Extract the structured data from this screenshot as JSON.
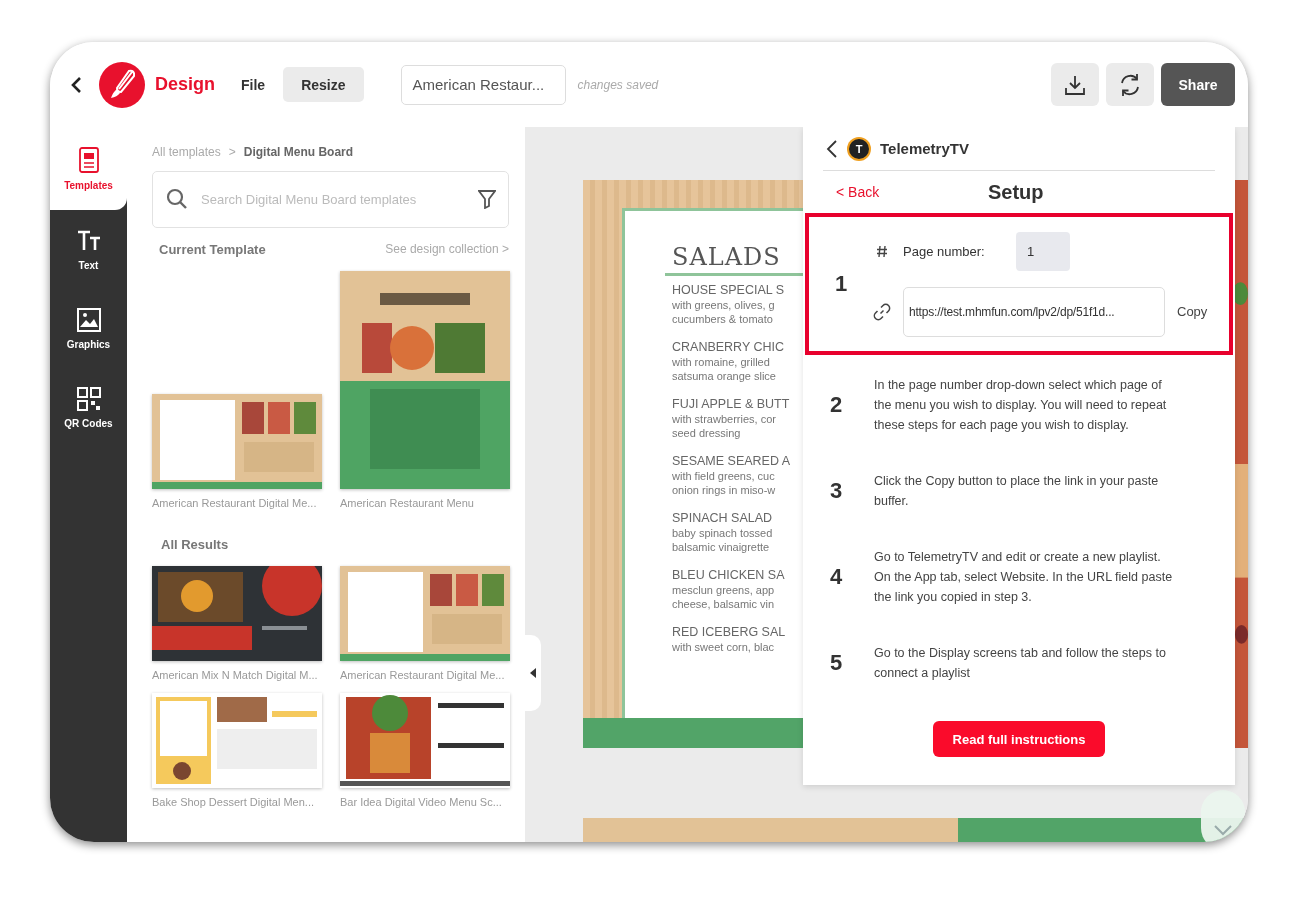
{
  "topbar": {
    "logo_text": "Design",
    "menu": [
      {
        "label": "File",
        "kind": "text"
      },
      {
        "label": "Resize",
        "kind": "button"
      }
    ],
    "document_title": "American Restaur...",
    "save_status": "changes saved",
    "share": "Share"
  },
  "rail": [
    {
      "label": "Templates",
      "selected": true
    },
    {
      "label": "Text",
      "selected": false
    },
    {
      "label": "Graphics",
      "selected": false
    },
    {
      "label": "QR Codes",
      "selected": false
    }
  ],
  "templates": {
    "breadcrumb": [
      "All templates",
      ">",
      "Digital Menu Board"
    ],
    "search_placeholder": "Search Digital Menu Board templates",
    "current_heading": "Current Template",
    "collection_link": "See design collection >",
    "current": [
      {
        "caption": "American Restaurant Digital Me...",
        "kind": "picture"
      },
      {
        "caption": "American Restaurant Menu",
        "kind": "picture"
      }
    ],
    "results_heading": "All Results",
    "results": [
      {
        "caption": "American Mix N Match Digital M...",
        "kind": "picture"
      },
      {
        "caption": "American Restaurant Digital Me...",
        "kind": "picture"
      },
      {
        "caption": "Bake Shop Dessert Digital Men...",
        "kind": "picture"
      },
      {
        "caption": "Bar Idea Digital Video Menu Sc...",
        "kind": "picture"
      }
    ]
  },
  "canvas": {
    "menu_title": "SALADS",
    "items": [
      {
        "name": "HOUSE SPECIAL S",
        "lines": [
          "with greens, olives, g",
          "cucumbers & tomato"
        ]
      },
      {
        "name": "CRANBERRY CHIC",
        "lines": [
          "with romaine, grilled",
          "satsuma orange slice"
        ]
      },
      {
        "name": "FUJI APPLE & BUTT",
        "lines": [
          "with strawberries, cor",
          "seed dressing"
        ]
      },
      {
        "name": "SESAME SEARED A",
        "lines": [
          "with field greens, cuc",
          "onion rings in miso-w"
        ]
      },
      {
        "name": "SPINACH SALAD",
        "lines": [
          "baby spinach tossed",
          "balsamic vinaigrette"
        ]
      },
      {
        "name": "BLEU CHICKEN SA",
        "lines": [
          "mesclun greens, app",
          "cheese, balsamic vin"
        ]
      },
      {
        "name": "RED ICEBERG SAL",
        "lines": [
          "with sweet corn, blac"
        ]
      }
    ]
  },
  "panel": {
    "app_name": "TelemetryTV",
    "logo_letter": "T",
    "back_link": "< Back",
    "title": "Setup",
    "step_one": {
      "number": "1",
      "page_label": "Page number:",
      "page_value": "1",
      "url": "https://test.mhmfun.com/lpv2/dp/51f1d...",
      "copy": "Copy"
    },
    "steps": [
      {
        "number": "2",
        "text": "In the page number drop-down select which page of the menu you wish to display. You will need to repeat these steps for each page you wish to display."
      },
      {
        "number": "3",
        "text": "Click the Copy button to place the link in your paste buffer."
      },
      {
        "number": "4",
        "text": "Go to TelemetryTV and edit or create a new playlist. On the App tab, select Website. In the URL field paste the link you copied in step 3."
      },
      {
        "number": "5",
        "text": "Go to the Display screens tab and follow the steps to connect a playlist"
      }
    ],
    "button": "Read full instructions"
  }
}
